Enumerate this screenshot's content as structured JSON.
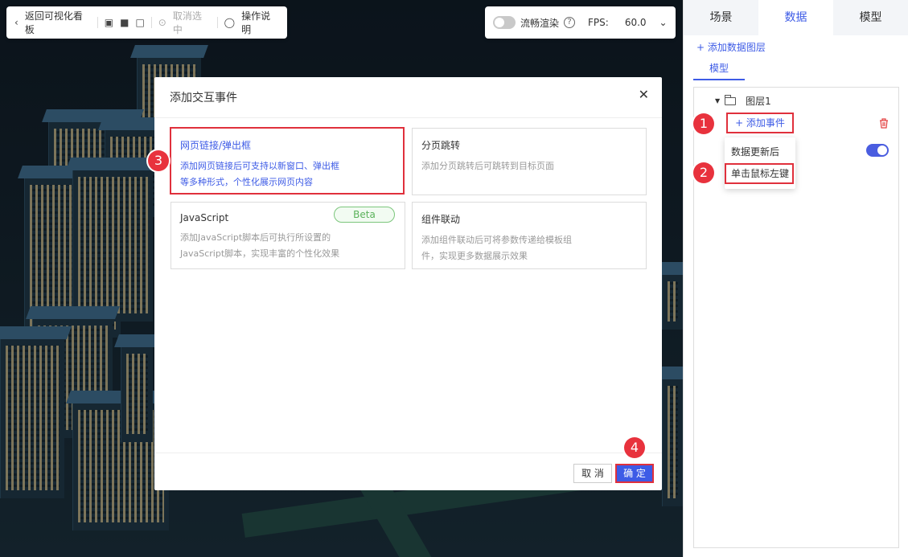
{
  "toolbar": {
    "back_label": "返回可视化看板",
    "cancel_select_label": "取消选中",
    "help_label": "操作说明",
    "smooth_render_label": "流畅渲染",
    "fps_label": "FPS:",
    "fps_value": "60.0"
  },
  "panel": {
    "tabs": [
      {
        "label": "场景",
        "active": false
      },
      {
        "label": "数据",
        "active": true
      },
      {
        "label": "模型",
        "active": false
      }
    ],
    "add_layer_label": "+ 添加数据图层",
    "subtab_label": "模型",
    "layer_name": "图层1",
    "add_event_label": "+ 添加事件",
    "dropdown_items": [
      "数据更新后",
      "单击鼠标左键"
    ]
  },
  "dialog": {
    "title": "添加交互事件",
    "cards": [
      {
        "title": "网页链接/弹出框",
        "desc1": "添加网页链接后可支持以新窗口、弹出框",
        "desc2": "等多种形式，个性化展示网页内容",
        "selected": true
      },
      {
        "title": "分页跳转",
        "desc1": "添加分页跳转后可跳转到目标页面",
        "desc2": "",
        "selected": false
      },
      {
        "title": "JavaScript",
        "desc1": "添加JavaScript脚本后可执行所设置的",
        "desc2": "JavaScript脚本，实现丰富的个性化效果",
        "badge": "Beta",
        "selected": false
      },
      {
        "title": "组件联动",
        "desc1": "添加组件联动后可将参数传递给模板组",
        "desc2": "件，实现更多数据展示效果",
        "selected": false
      }
    ],
    "cancel_label": "取 消",
    "confirm_label": "确 定"
  },
  "steps": [
    "1",
    "2",
    "3",
    "4"
  ],
  "colors": {
    "accent": "#3d5be6",
    "highlight": "#e0303c",
    "beta": "#5bb25b"
  }
}
